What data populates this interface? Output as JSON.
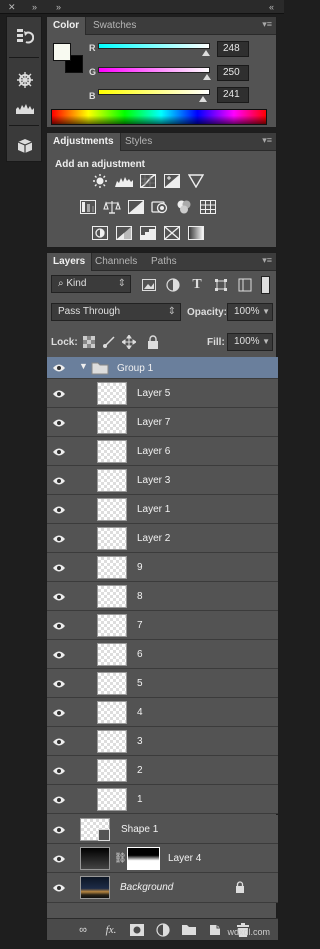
{
  "color_panel": {
    "tabs": [
      "Color",
      "Swatches"
    ],
    "foreground": "#f8faf1",
    "background": "#000000",
    "channels": [
      {
        "label": "R",
        "value": "248",
        "level": 0.973
      },
      {
        "label": "G",
        "value": "250",
        "level": 0.98
      },
      {
        "label": "B",
        "value": "241",
        "level": 0.945
      }
    ]
  },
  "adjustments_panel": {
    "tabs": [
      "Adjustments",
      "Styles"
    ],
    "title": "Add an adjustment",
    "icons": [
      [
        "brightness-contrast-icon",
        "levels-icon",
        "curves-icon",
        "exposure-icon",
        "vibrance-icon"
      ],
      [
        "hue-saturation-icon",
        "color-balance-icon",
        "black-white-icon",
        "photo-filter-icon",
        "channel-mixer-icon",
        "color-lookup-icon"
      ],
      [
        "invert-icon",
        "posterize-icon",
        "threshold-icon",
        "selective-color-icon",
        "gradient-map-icon"
      ]
    ]
  },
  "layers_panel": {
    "tabs": [
      "Layers",
      "Channels",
      "Paths"
    ],
    "filter_kind": "Kind",
    "blend_mode": "Pass Through",
    "opacity_label": "Opacity:",
    "opacity": "100%",
    "lock_label": "Lock:",
    "fill_label": "Fill:",
    "fill": "100%",
    "group_name": "Group 1",
    "layers": [
      "Layer 5",
      "Layer 7",
      "Layer 6",
      "Layer 3",
      "Layer 1",
      "Layer 2",
      "9",
      "8",
      "7",
      "6",
      "5",
      "4",
      "3",
      "2",
      "1"
    ],
    "shape_layer": "Shape 1",
    "mask_layer": "Layer 4",
    "background_layer": "Background"
  },
  "watermark": "wdxdl.com"
}
